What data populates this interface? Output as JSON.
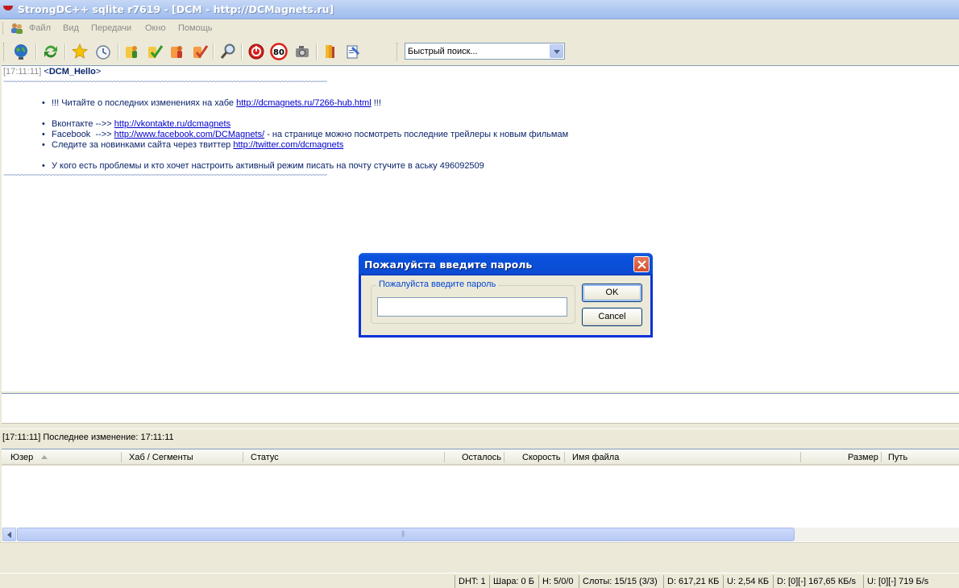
{
  "window": {
    "title": "StrongDC++ sqlite r7619 - [DCM - http://DCMagnets.ru]"
  },
  "menu": [
    "Файл",
    "Вид",
    "Передачи",
    "Окно",
    "Помощь"
  ],
  "toolbar": {
    "quick_search_value": "Быстрый поиск...",
    "buttons": [
      "globe-icon",
      "refresh-icon",
      "star-icon",
      "clock-icon",
      "hub-user-icon",
      "hub-check-icon",
      "hub-user-orange-icon",
      "hub-check-orange-icon",
      "search-icon",
      "power-icon",
      "limit-80-icon",
      "camera-icon",
      "books-icon",
      "notepad-icon"
    ],
    "limit_label": "80"
  },
  "chat": {
    "header_timestamp": "[17:11:11]",
    "header_nick_open": "<",
    "header_nick": "DCM_Hello",
    "header_nick_close": ">",
    "wave": "~~~~~~~~~~~~~~~~~~~~~~~~~~~~~~~~~~~~~~~~~~~~~~~~~~~~~~~~~~~~~~~~~~~~~~~~~~~~~~~~~~~~~~~~~~~~~~~~~~~~~~~~~~~~~~~~~~~~~~~~~~~~~~~~~~~~~~~~",
    "bullet": "•",
    "line1_prefix": "!!! Читайте о последних изменениях на хабе",
    "line1_link": "http://dcmagnets.ru/7266-hub.html",
    "line1_suffix": "!!!",
    "line2_prefix": "Вконтакте -->>",
    "line2_link": "http://vkontakte.ru/dcmagnets",
    "line3_prefix": "Facebook  -->>",
    "line3_link": "http://www.facebook.com/DCMagnets/",
    "line3_suffix": "- на странице можно посмотреть последние трейлеры к новым фильмам",
    "line4_prefix": "Следите за новинками сайта через твиттер",
    "line4_link": "http://twitter.com/dcmagnets",
    "line5": "У кого есть проблемы и кто хочет настроить активный режим писать на почту стучите в аську 496092509"
  },
  "hub_status": "[17:11:11] Последнее изменение:  17:11:11",
  "transfers": {
    "columns": [
      "Юзер",
      "Хаб / Сегменты",
      "Статус",
      "Осталось",
      "Скорость",
      "Имя файла",
      "Размер",
      "Путь"
    ]
  },
  "statusbar": [
    "DHT: 1",
    "Шара: 0 Б",
    "H: 5/0/0",
    "Слоты: 15/15 (3/3)",
    "D: 617,21 КБ",
    "U: 2,54 КБ",
    "D: [0][-] 167,65 КБ/s",
    "U: [0][-] 719 Б/s"
  ],
  "dialog": {
    "title": "Пожалуйста введите пароль",
    "group_label": "Пожалуйста введите пароль",
    "password_value": "",
    "ok_label": "OK",
    "cancel_label": "Cancel"
  }
}
